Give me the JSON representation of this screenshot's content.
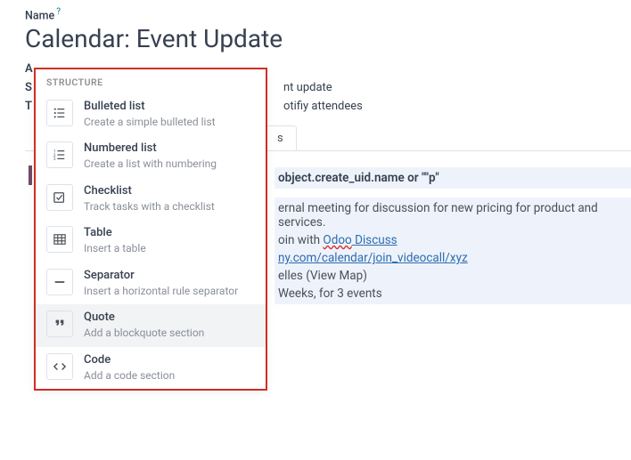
{
  "field_label": "Name",
  "help_mark": "?",
  "title": "Calendar: Event Update",
  "rows": [
    {
      "label": "A",
      "value": ""
    },
    {
      "label": "S",
      "value": "nt update"
    },
    {
      "label": "T",
      "value": "otifiy attendees"
    }
  ],
  "tab_label": "s",
  "content": {
    "line1": "object.create_uid.name or \"\"p\"",
    "line2_a": "ernal meeting for discussion for new pricing for product and services.",
    "line3_a": "oin with ",
    "line3_link1": "Odoo",
    "line3_link2": " Discuss",
    "line4": "ny.com/calendar/join_videocall/xyz",
    "line5": "elles (View Map)",
    "line6": "Weeks, for 3 events"
  },
  "slash_char": "/",
  "popup": {
    "section": "STRUCTURE",
    "items": [
      {
        "title": "Bulleted list",
        "desc": "Create a simple bulleted list"
      },
      {
        "title": "Numbered list",
        "desc": "Create a list with numbering"
      },
      {
        "title": "Checklist",
        "desc": "Track tasks with a checklist"
      },
      {
        "title": "Table",
        "desc": "Insert a table"
      },
      {
        "title": "Separator",
        "desc": "Insert a horizontal rule separator"
      },
      {
        "title": "Quote",
        "desc": "Add a blockquote section"
      },
      {
        "title": "Code",
        "desc": "Add a code section"
      }
    ]
  }
}
